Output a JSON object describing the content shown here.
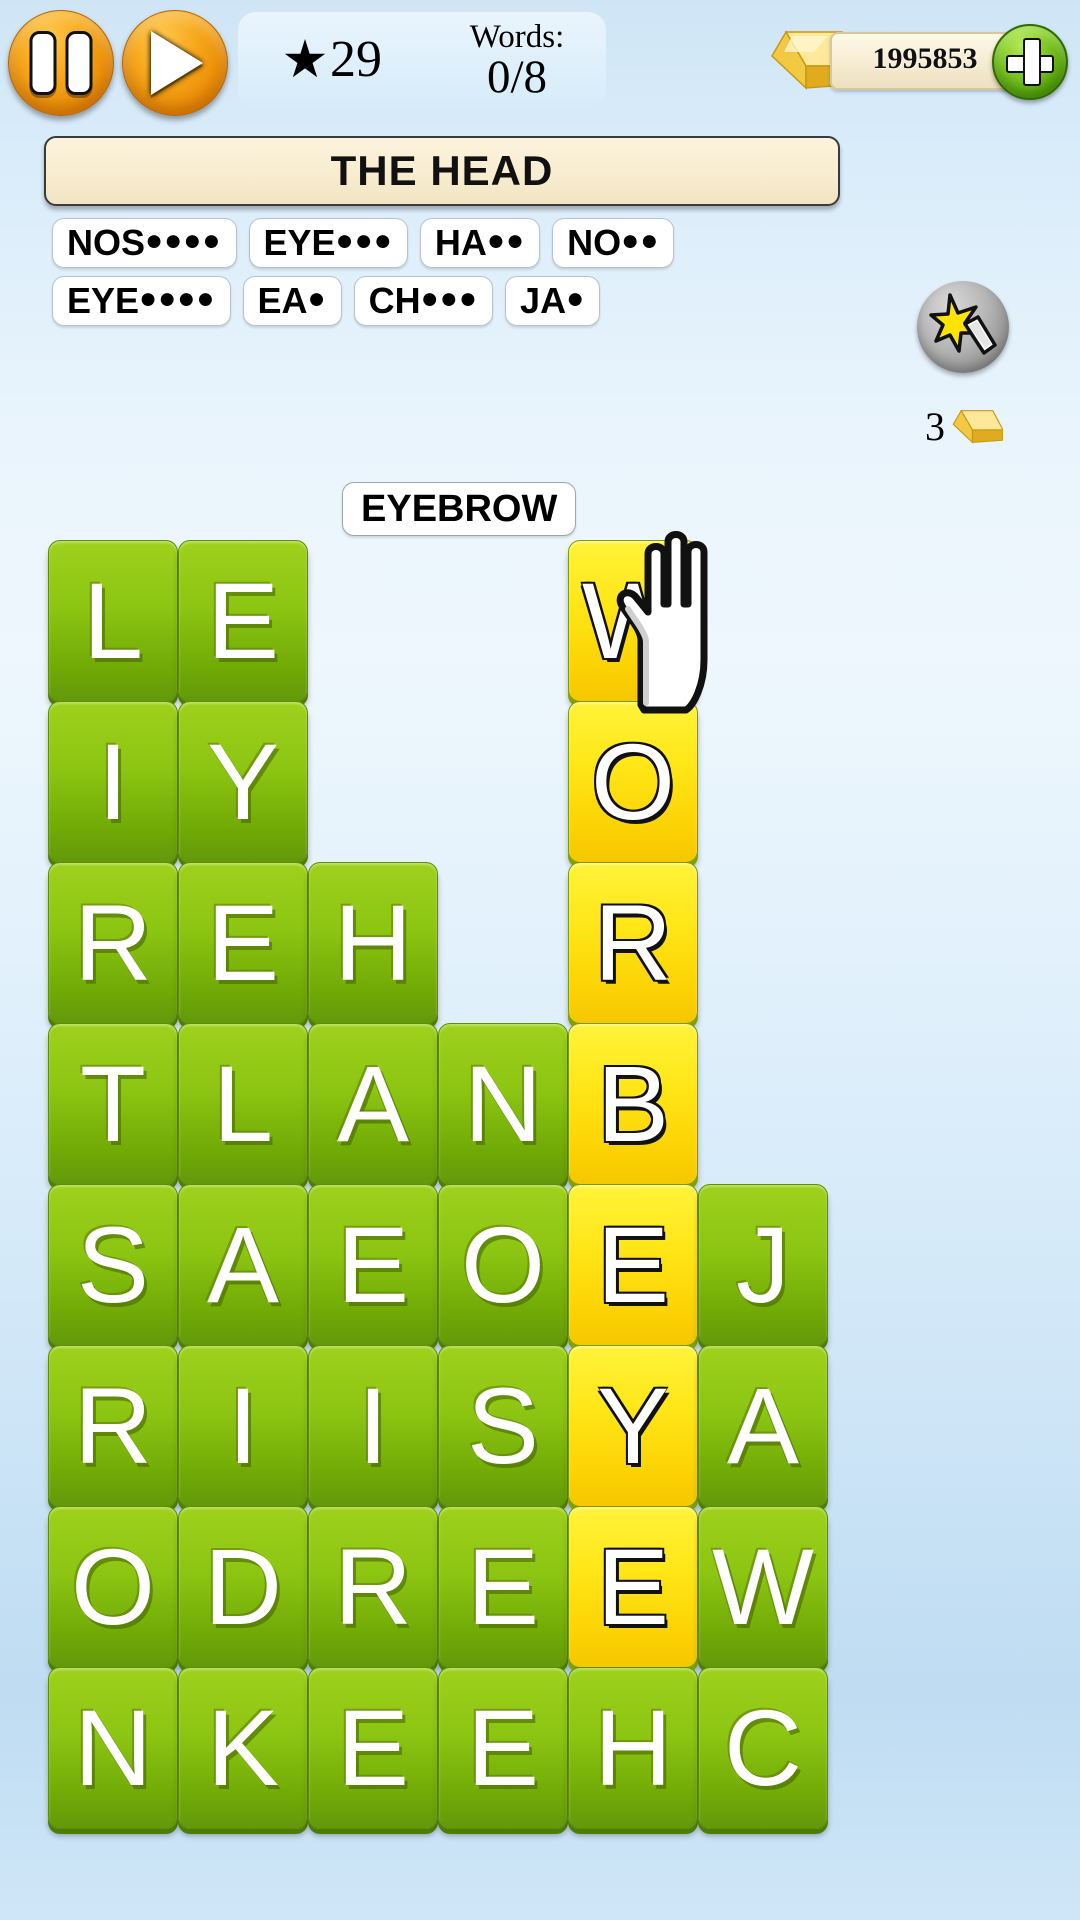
{
  "topbar": {
    "pause_label": "pause-icon",
    "play_label": "play-icon",
    "star_count": "29",
    "words_label": "Words:",
    "words_value": "0/8",
    "gold_value": "1995853",
    "add_label": "plus-icon"
  },
  "category": {
    "title": "THE HEAD"
  },
  "hints": {
    "rows": [
      [
        {
          "prefix": "NOS",
          "dots": "●●●●"
        },
        {
          "prefix": "EYE",
          "dots": "●●●"
        },
        {
          "prefix": "HA",
          "dots": "●●"
        },
        {
          "prefix": "NO",
          "dots": "●●"
        }
      ],
      [
        {
          "prefix": "EYE",
          "dots": "●●●●"
        },
        {
          "prefix": "EA",
          "dots": "●"
        },
        {
          "prefix": "CH",
          "dots": "●●●"
        },
        {
          "prefix": "JA",
          "dots": "●"
        }
      ]
    ]
  },
  "hint_button": {
    "icon": "magic-wand-icon",
    "cost": "3",
    "currency": "gold-bar-icon"
  },
  "current_word": {
    "text": "EYEBROW"
  },
  "grid": {
    "columns": 6,
    "rows": 8,
    "cells": [
      [
        {
          "letter": "L",
          "state": "green"
        },
        {
          "letter": "E",
          "state": "green"
        },
        null,
        null,
        {
          "letter": "W",
          "state": "yellow"
        },
        null
      ],
      [
        {
          "letter": "I",
          "state": "green"
        },
        {
          "letter": "Y",
          "state": "green"
        },
        null,
        null,
        {
          "letter": "O",
          "state": "yellow"
        },
        null
      ],
      [
        {
          "letter": "R",
          "state": "green"
        },
        {
          "letter": "E",
          "state": "green"
        },
        {
          "letter": "H",
          "state": "green"
        },
        null,
        {
          "letter": "R",
          "state": "yellow"
        },
        null
      ],
      [
        {
          "letter": "T",
          "state": "green"
        },
        {
          "letter": "L",
          "state": "green"
        },
        {
          "letter": "A",
          "state": "green"
        },
        {
          "letter": "N",
          "state": "green"
        },
        {
          "letter": "B",
          "state": "yellow"
        },
        null
      ],
      [
        {
          "letter": "S",
          "state": "green"
        },
        {
          "letter": "A",
          "state": "green"
        },
        {
          "letter": "E",
          "state": "green"
        },
        {
          "letter": "O",
          "state": "green"
        },
        {
          "letter": "E",
          "state": "yellow"
        },
        {
          "letter": "J",
          "state": "green"
        }
      ],
      [
        {
          "letter": "R",
          "state": "green"
        },
        {
          "letter": "I",
          "state": "green"
        },
        {
          "letter": "I",
          "state": "green"
        },
        {
          "letter": "S",
          "state": "green"
        },
        {
          "letter": "Y",
          "state": "yellow"
        },
        {
          "letter": "A",
          "state": "green"
        }
      ],
      [
        {
          "letter": "O",
          "state": "green"
        },
        {
          "letter": "D",
          "state": "green"
        },
        {
          "letter": "R",
          "state": "green"
        },
        {
          "letter": "E",
          "state": "green"
        },
        {
          "letter": "E",
          "state": "yellow"
        },
        {
          "letter": "W",
          "state": "green"
        }
      ],
      [
        {
          "letter": "N",
          "state": "green"
        },
        {
          "letter": "K",
          "state": "green"
        },
        {
          "letter": "E",
          "state": "green"
        },
        {
          "letter": "E",
          "state": "green"
        },
        {
          "letter": "H",
          "state": "green"
        },
        {
          "letter": "C",
          "state": "green"
        }
      ]
    ]
  },
  "cursor": {
    "icon": "hand-pointer-icon"
  },
  "colors": {
    "tile_green": "#8cc512",
    "tile_yellow": "#ffe617",
    "button_orange": "#f7a81c",
    "button_green": "#7dc623",
    "background": "#d9ecfa"
  }
}
